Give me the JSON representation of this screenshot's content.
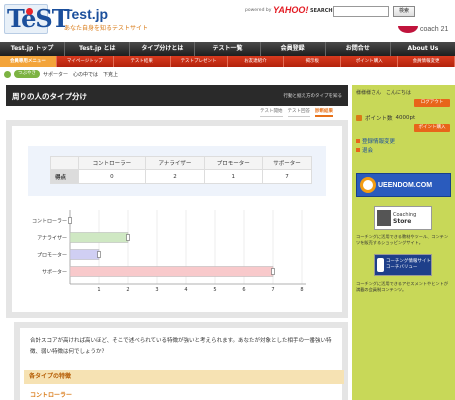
{
  "header": {
    "logo_text": "TeST",
    "brand_name": "Test.jp",
    "brand_sub": "あなた自身を知るテストサイト",
    "search_powered": "powered by",
    "search_brand": "YAHOO!",
    "search_word": "SEARCH",
    "search_value": "",
    "search_button": "検索",
    "coach_brand": "coach 21"
  },
  "mainnav": {
    "items": [
      "Test.jp トップ",
      "Test.jp とは",
      "タイプ分けとは",
      "テスト一覧",
      "会員登録",
      "お問合せ",
      "About Us"
    ]
  },
  "subnav": {
    "items": [
      "会員専用メニュー",
      "マイページトップ",
      "テスト結果",
      "テストプレゼント",
      "お友達紹介",
      "掲示板",
      "ポイント購入",
      "会員情報変更"
    ]
  },
  "breadcrumb": {
    "badge": "つぶやき",
    "text": "サポーター　心の中では　下克上"
  },
  "content": {
    "title": "周りの人のタイプ分け",
    "title_sub": "行動と据え方のタイプを知る",
    "steps": [
      "テスト開始",
      "テスト回答",
      "診断結果"
    ]
  },
  "score_table": {
    "headers": [
      "",
      "コントローラー",
      "アナライザー",
      "プロモーター",
      "サポーター"
    ],
    "row_label": "得点",
    "values": [
      "0",
      "2",
      "1",
      "7"
    ]
  },
  "chart_data": {
    "type": "bar",
    "orientation": "horizontal",
    "categories": [
      "コントローラー",
      "アナライザー",
      "プロモーター",
      "サポーター"
    ],
    "values": [
      0,
      2,
      1,
      7
    ],
    "colors": [
      "#dddddd",
      "#cfe8c3",
      "#d0cff3",
      "#f8c9cb"
    ],
    "xticks": [
      "1",
      "2",
      "3",
      "4",
      "5",
      "6",
      "7",
      "8"
    ],
    "xlim": [
      0,
      8
    ],
    "title": "",
    "xlabel": "",
    "ylabel": ""
  },
  "description": {
    "text": "合計スコアが高ければ高いほど、そこで述べられている特徴が強いと考えられます。あなたが対象とした相手の一番強い特徴、弱い特徴は何でしょうか？",
    "section_head": "各タイプの特徴",
    "first_type": "コントローラー"
  },
  "sidebar": {
    "user_greeting": "様様様さん　こんにちは",
    "logout": "ログアウト",
    "points_label": "ポイント数",
    "points_value": "4000pt",
    "point_button": "ポイント購入",
    "link1": "登録情報変更",
    "link2": "退会",
    "banner_q_text": "UEENDOM.COM",
    "coach_store_title": "Coaching",
    "coach_store_name": "Store",
    "coach_store_desc": "コーチングに活用できる教材やツール、コンテンツを販売するショッピングサイト。",
    "cv_text": "コーチング情報サイト コーチバリュー",
    "cv_desc": "コーチングに活用できるアセスメントやヒントが満載の会員制コンテンツ。",
    "accent": "#c8d858"
  }
}
